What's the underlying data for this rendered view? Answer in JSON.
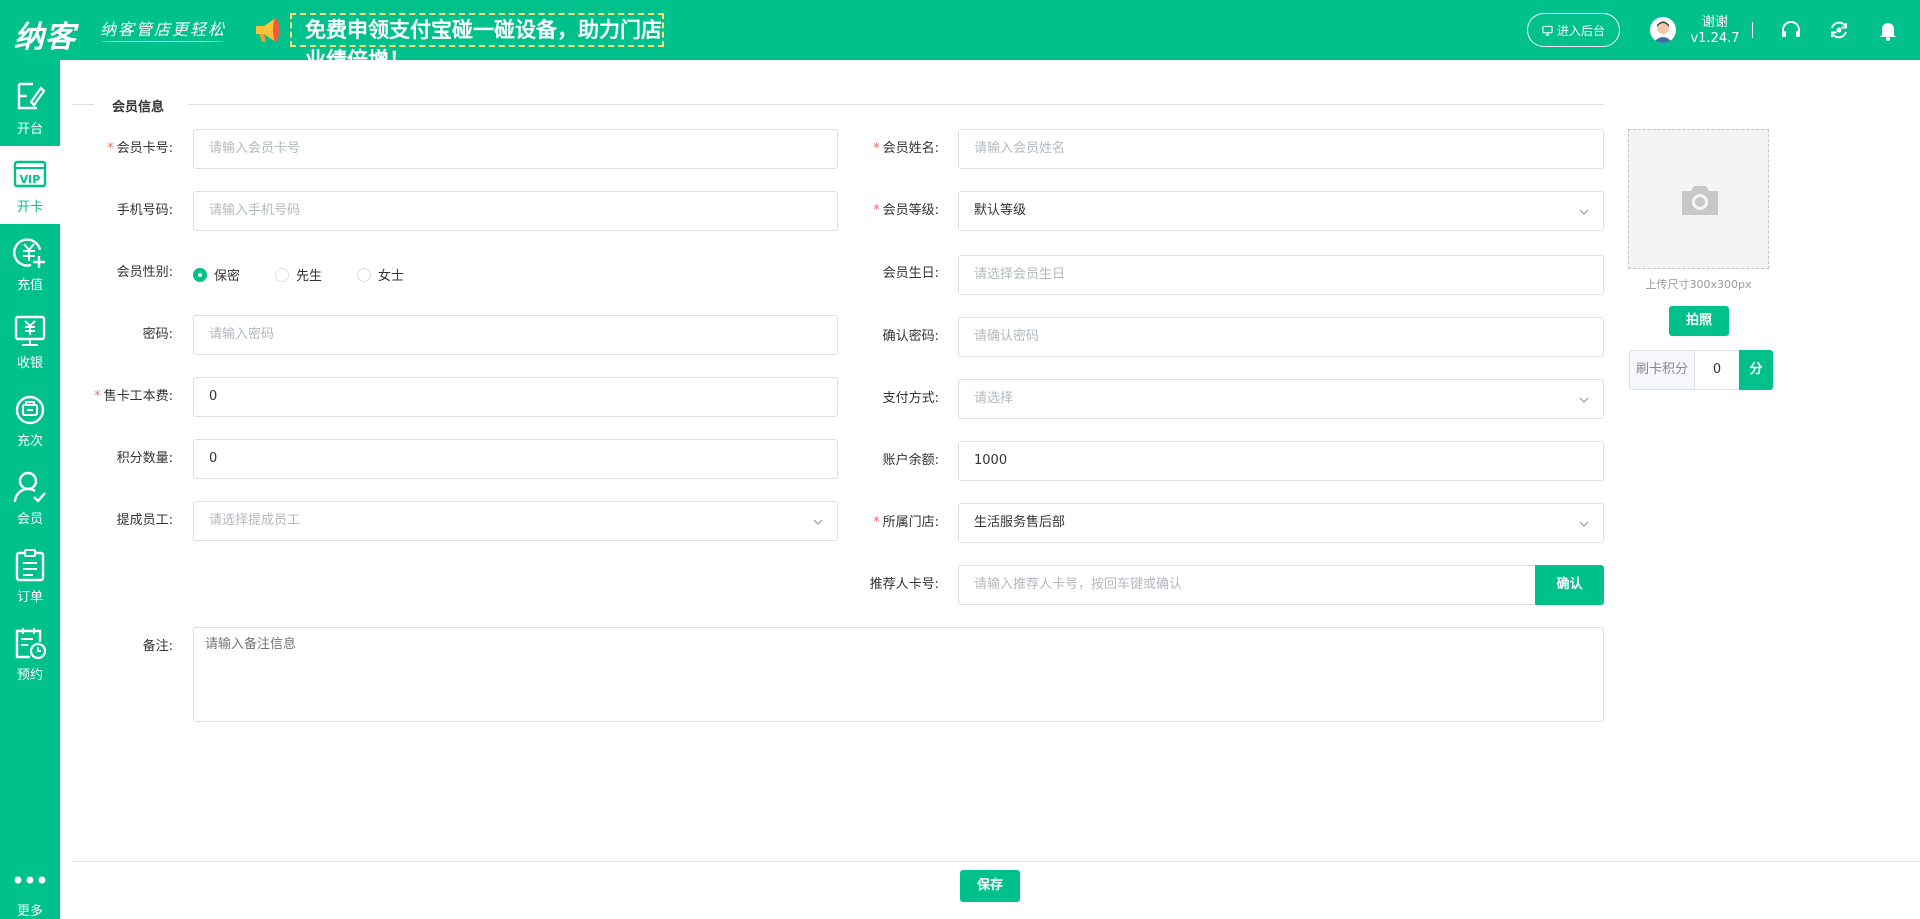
{
  "header": {
    "logo": "纳客",
    "slogan": "纳客管店更轻松",
    "promo": "免费申领支付宝碰一碰设备，助力门店业绩倍增！",
    "backend_btn": "进入后台",
    "user_name": "谢谢",
    "version": "v1.24.7"
  },
  "sidebar": {
    "items": [
      {
        "label": "开台",
        "icon": "table-icon"
      },
      {
        "label": "开卡",
        "icon": "vip-card-icon"
      },
      {
        "label": "充值",
        "icon": "recharge-icon"
      },
      {
        "label": "收银",
        "icon": "cashier-icon"
      },
      {
        "label": "充次",
        "icon": "recharge-times-icon"
      },
      {
        "label": "会员",
        "icon": "member-icon"
      },
      {
        "label": "订单",
        "icon": "order-icon"
      },
      {
        "label": "预约",
        "icon": "reservation-icon"
      }
    ],
    "active_index": 1,
    "more": "更多"
  },
  "form": {
    "section_title": "会员信息",
    "card_no": {
      "label": "会员卡号:",
      "placeholder": "请输入会员卡号"
    },
    "name": {
      "label": "会员姓名:",
      "placeholder": "请输入会员姓名"
    },
    "phone": {
      "label": "手机号码:",
      "placeholder": "请输入手机号码"
    },
    "level": {
      "label": "会员等级:",
      "value": "默认等级"
    },
    "gender": {
      "label": "会员性别:",
      "options": [
        "保密",
        "先生",
        "女士"
      ],
      "selected": "保密"
    },
    "birthday": {
      "label": "会员生日:",
      "placeholder": "请选择会员生日"
    },
    "password": {
      "label": "密码:",
      "placeholder": "请输入密码"
    },
    "confirm_password": {
      "label": "确认密码:",
      "placeholder": "请确认密码"
    },
    "card_fee": {
      "label": "售卡工本费:",
      "value": "0"
    },
    "pay_method": {
      "label": "支付方式:",
      "placeholder": "请选择"
    },
    "points": {
      "label": "积分数量:",
      "value": "0"
    },
    "balance": {
      "label": "账户余额:",
      "value": "1000"
    },
    "staff": {
      "label": "提成员工:",
      "placeholder": "请选择提成员工"
    },
    "store": {
      "label": "所属门店:",
      "value": "生活服务售后部"
    },
    "referrer": {
      "label": "推荐人卡号:",
      "placeholder": "请输入推荐人卡号，按回车键或确认",
      "button": "确认"
    },
    "remark": {
      "label": "备注:",
      "placeholder": "请输入备注信息"
    }
  },
  "photo": {
    "tip": "上传尺寸300x300px",
    "shoot_btn": "拍照",
    "swipe_label": "刷卡积分",
    "swipe_value": "0",
    "swipe_unit": "分"
  },
  "footer": {
    "save": "保存"
  },
  "colors": {
    "accent": "#00c08b",
    "required": "#f56c6c",
    "promo_border": "#ffe27a"
  }
}
